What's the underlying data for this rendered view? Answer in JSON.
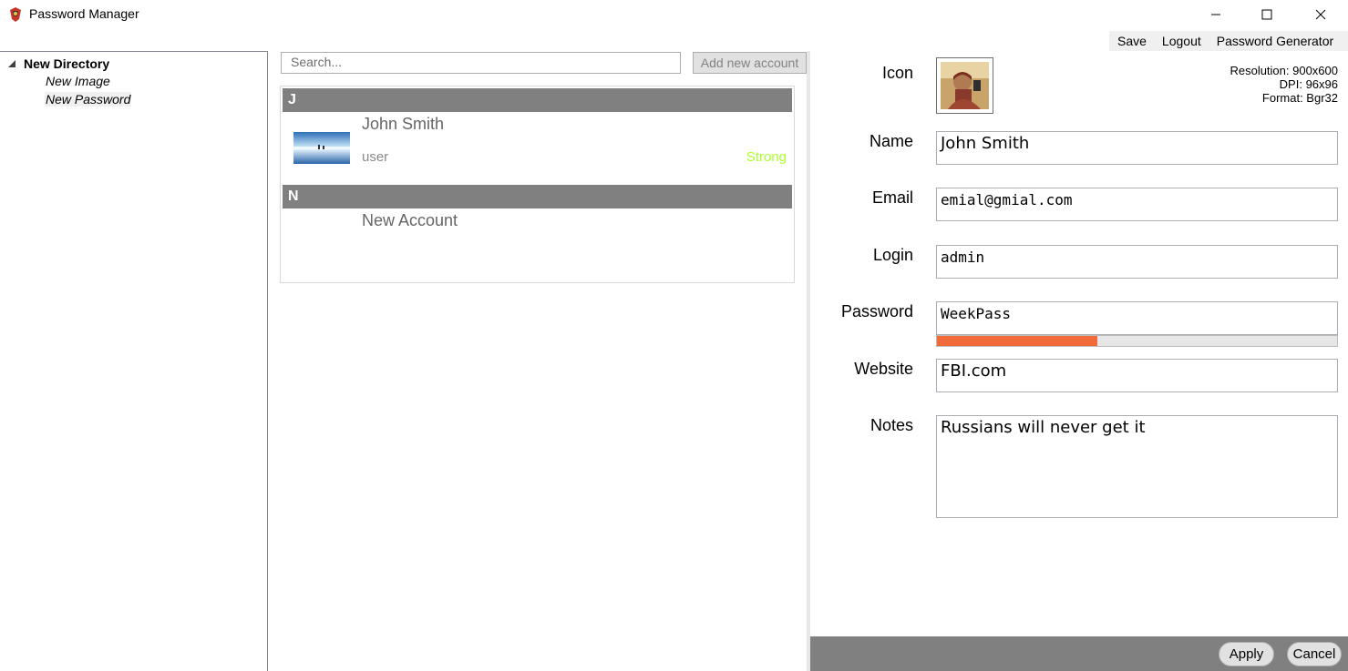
{
  "window": {
    "title": "Password Manager",
    "app_icon": "app-icon",
    "controls": [
      "minimize-icon",
      "maximize-icon",
      "close-icon"
    ]
  },
  "menu": {
    "save": "Save",
    "logout": "Logout",
    "generator": "Password Generator"
  },
  "tree": {
    "root": "New Directory",
    "children": [
      "New Image",
      "New Password"
    ],
    "selected_index": 1
  },
  "search": {
    "placeholder": "Search...",
    "value": ""
  },
  "add_button": "Add new account",
  "accounts": {
    "groups": [
      {
        "header": "J",
        "items": [
          {
            "name": "John Smith",
            "user": "user",
            "strength": "Strong",
            "has_thumbnail": true
          }
        ]
      },
      {
        "header": "N",
        "items": [
          {
            "name": "New Account",
            "user": "",
            "strength": "",
            "has_thumbnail": false
          }
        ]
      }
    ]
  },
  "details": {
    "labels": {
      "icon": "Icon",
      "name": "Name",
      "email": "Email",
      "login": "Login",
      "password": "Password",
      "website": "Website",
      "notes": "Notes"
    },
    "icon_meta": {
      "resolution": "Resolution: 900x600",
      "dpi": "DPI: 96x96",
      "format": "Format: Bgr32"
    },
    "values": {
      "name": "John Smith",
      "email": "emial@gmial.com",
      "login": "admin",
      "password": "WeekPass",
      "website": "FBI.com",
      "notes": "Russians will never get it"
    },
    "password_strength_fraction": 0.4
  },
  "actions": {
    "apply": "Apply",
    "cancel": "Cancel"
  },
  "colors": {
    "group_header": "#808080",
    "strength_text": "#adff2f",
    "strength_bar": "#f06a3a",
    "bottom_bar": "#808080"
  }
}
